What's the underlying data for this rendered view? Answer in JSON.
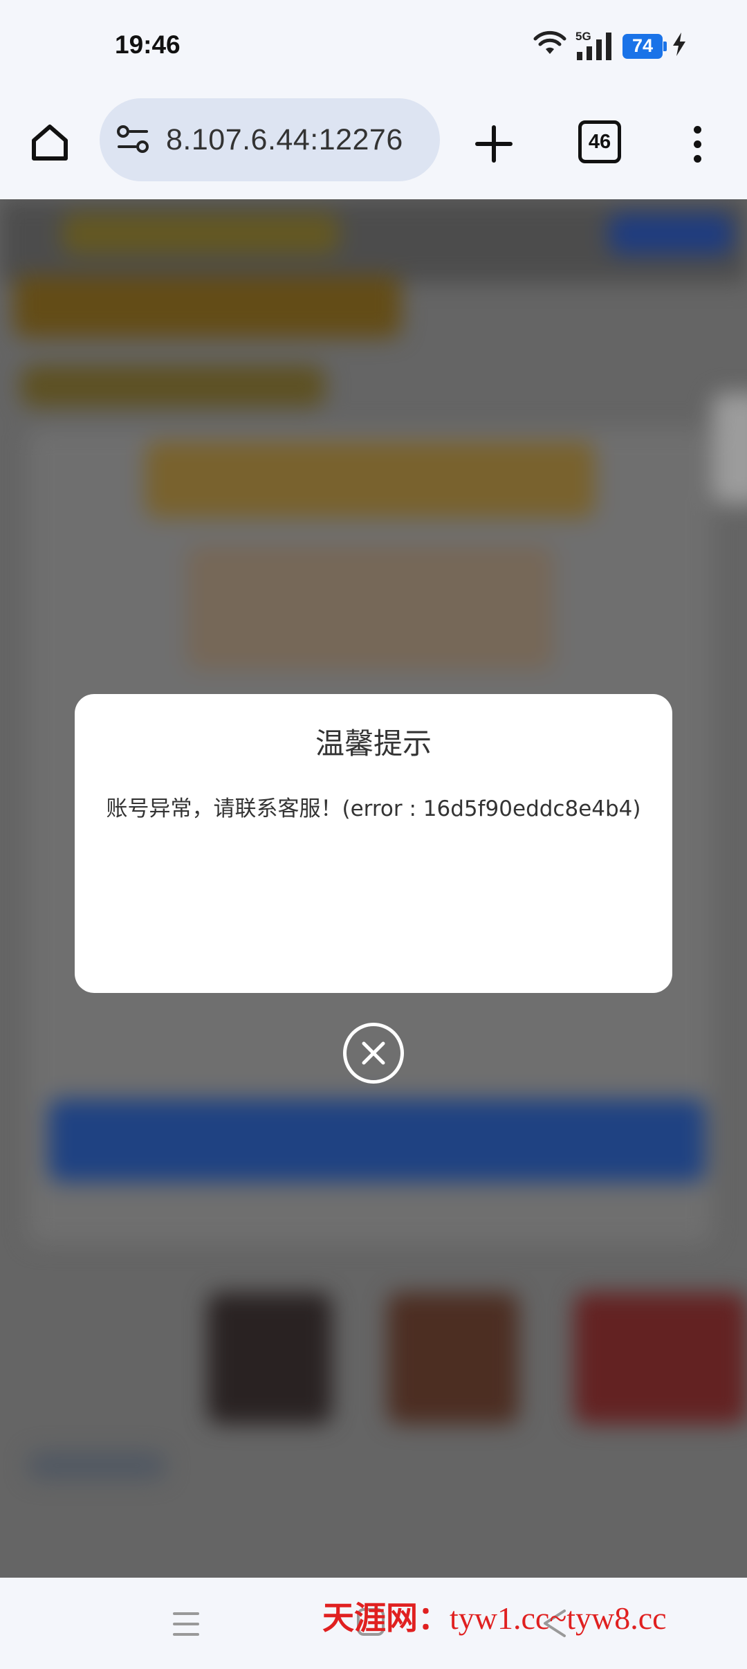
{
  "status_bar": {
    "time": "19:46",
    "network": "5G",
    "battery": "74",
    "icons": [
      "wifi-icon",
      "signal-5g-icon",
      "battery-icon",
      "charging-icon"
    ]
  },
  "browser": {
    "url": "8.107.6.44:12276",
    "tab_count": "46",
    "icons": [
      "home-icon",
      "site-settings-icon",
      "new-tab-icon",
      "tab-switcher-icon",
      "more-menu-icon"
    ]
  },
  "dialog": {
    "title": "温馨提示",
    "message": "账号异常，请联系客服！(error : 16d5f90eddc8e4b4)"
  },
  "navigation": {
    "icons": [
      "recents-icon",
      "nav-home-icon",
      "back-icon"
    ]
  },
  "watermark": {
    "site_name": "天涯网：",
    "urls": "tyw1.cc~tyw8.cc"
  },
  "colors": {
    "accent": "#1a73e8",
    "url_bar": "#dde4f2",
    "watermark": "#e02020",
    "backdrop": "#8c8c8c"
  }
}
